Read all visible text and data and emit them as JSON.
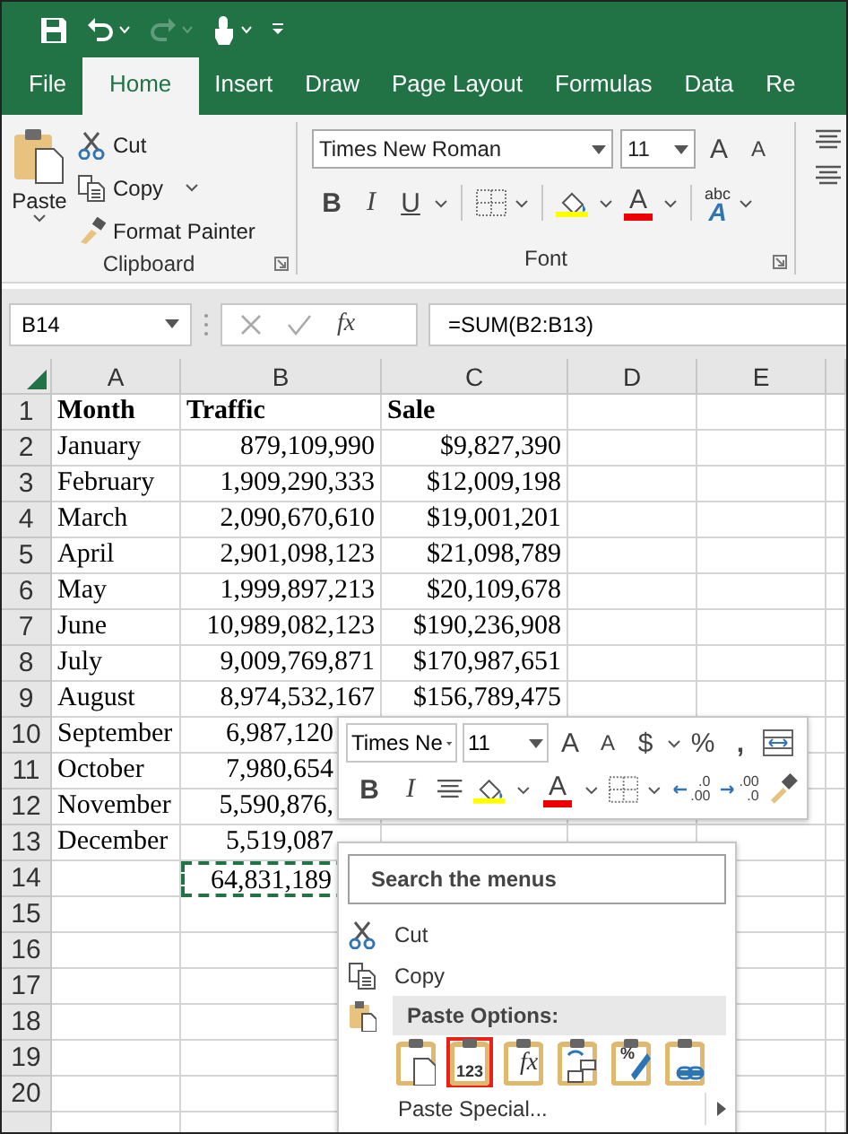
{
  "quick_access": {
    "redo_enabled": false
  },
  "tabs": [
    {
      "label": "File",
      "selected": false
    },
    {
      "label": "Home",
      "selected": true
    },
    {
      "label": "Insert",
      "selected": false
    },
    {
      "label": "Draw",
      "selected": false
    },
    {
      "label": "Page Layout",
      "selected": false
    },
    {
      "label": "Formulas",
      "selected": false
    },
    {
      "label": "Data",
      "selected": false
    },
    {
      "label": "Re",
      "selected": false
    }
  ],
  "clipboard": {
    "paste_label": "Paste",
    "group_label": "Clipboard",
    "commands": [
      {
        "kind": "cut",
        "label": "Cut"
      },
      {
        "kind": "copy",
        "label": "Copy"
      },
      {
        "kind": "painter",
        "label": "Format Painter"
      }
    ]
  },
  "font": {
    "font_name": "Times New Roman",
    "font_size": "11",
    "grow": "A",
    "shrink": "A",
    "bold": "B",
    "italic": "I",
    "underline": "U",
    "font_color": "A",
    "phonetic_top": "abc",
    "phonetic_bottom": "A",
    "group_label": "Font"
  },
  "formula_bar": {
    "name_box": "B14",
    "function": "fx",
    "formula": "=SUM(B2:B13)"
  },
  "sheet": {
    "columns": [
      "A",
      "B",
      "C",
      "D",
      "E"
    ],
    "rows": [
      {
        "n": "1",
        "kind": "header",
        "cells": [
          "Month",
          "Traffic",
          "Sale"
        ]
      },
      {
        "n": "2",
        "kind": "data",
        "cells": [
          "January",
          "879,109,990",
          "$9,827,390"
        ]
      },
      {
        "n": "3",
        "kind": "data",
        "cells": [
          "February",
          "1,909,290,333",
          "$12,009,198"
        ]
      },
      {
        "n": "4",
        "kind": "data",
        "cells": [
          "March",
          "2,090,670,610",
          "$19,001,201"
        ]
      },
      {
        "n": "5",
        "kind": "data",
        "cells": [
          "April",
          "2,901,098,123",
          "$21,098,789"
        ]
      },
      {
        "n": "6",
        "kind": "data",
        "cells": [
          "May",
          "1,999,897,213",
          "$20,109,678"
        ]
      },
      {
        "n": "7",
        "kind": "data",
        "cells": [
          "June",
          "10,989,082,123",
          "$190,236,908"
        ]
      },
      {
        "n": "8",
        "kind": "data",
        "cells": [
          "July",
          "9,009,769,871",
          "$170,987,651"
        ]
      },
      {
        "n": "9",
        "kind": "data",
        "cells": [
          "August",
          "8,974,532,167",
          "$156,789,475"
        ]
      },
      {
        "n": "10",
        "kind": "data",
        "cells": [
          "September",
          {
            "text": "6,987,120",
            "clipped": true
          }
        ]
      },
      {
        "n": "11",
        "kind": "data",
        "cells": [
          "October",
          {
            "text": "7,980,654",
            "clipped": true
          }
        ]
      },
      {
        "n": "12",
        "kind": "data",
        "cells": [
          "November",
          {
            "text": "5,590,876,",
            "clipped": true
          }
        ]
      },
      {
        "n": "13",
        "kind": "data",
        "cells": [
          "December",
          {
            "text": "5,519,087",
            "clipped": true
          }
        ]
      },
      {
        "n": "14",
        "kind": "data",
        "cells": [
          null,
          {
            "text": "64,831,189",
            "clipped": true,
            "copied": true
          }
        ]
      },
      {
        "n": "15",
        "kind": "data"
      },
      {
        "n": "16",
        "kind": "data"
      },
      {
        "n": "17",
        "kind": "data"
      },
      {
        "n": "18",
        "kind": "data"
      },
      {
        "n": "19",
        "kind": "data"
      },
      {
        "n": "20",
        "kind": "data"
      }
    ]
  },
  "mini_toolbar": {
    "font_name": "Times Ne",
    "font_size": "11",
    "grow": "A",
    "shrink": "A",
    "currency": "$",
    "percent": "%",
    "comma": ",",
    "bold": "B",
    "italic": "I",
    "font_color": "A",
    "increase_decimal": [
      ".0",
      ".00"
    ],
    "decrease_decimal": [
      ".00",
      ".0"
    ]
  },
  "context_menu": {
    "search_placeholder": "Search the menus",
    "items": [
      {
        "kind": "cut",
        "label": "Cut"
      },
      {
        "kind": "copy",
        "label": "Copy"
      },
      {
        "kind": "paste_section",
        "label": "Paste Options:"
      },
      {
        "kind": "paste_row",
        "options": [
          {
            "kind": "paste",
            "selected": false
          },
          {
            "kind": "values",
            "glyph": "123",
            "selected": true
          },
          {
            "kind": "formulas",
            "glyph": "fx",
            "selected": false
          },
          {
            "kind": "transpose",
            "selected": false
          },
          {
            "kind": "formatting",
            "glyph": "%",
            "selected": false
          },
          {
            "kind": "link",
            "selected": false
          }
        ]
      },
      {
        "kind": "submenu",
        "label": "Paste Special..."
      }
    ]
  }
}
